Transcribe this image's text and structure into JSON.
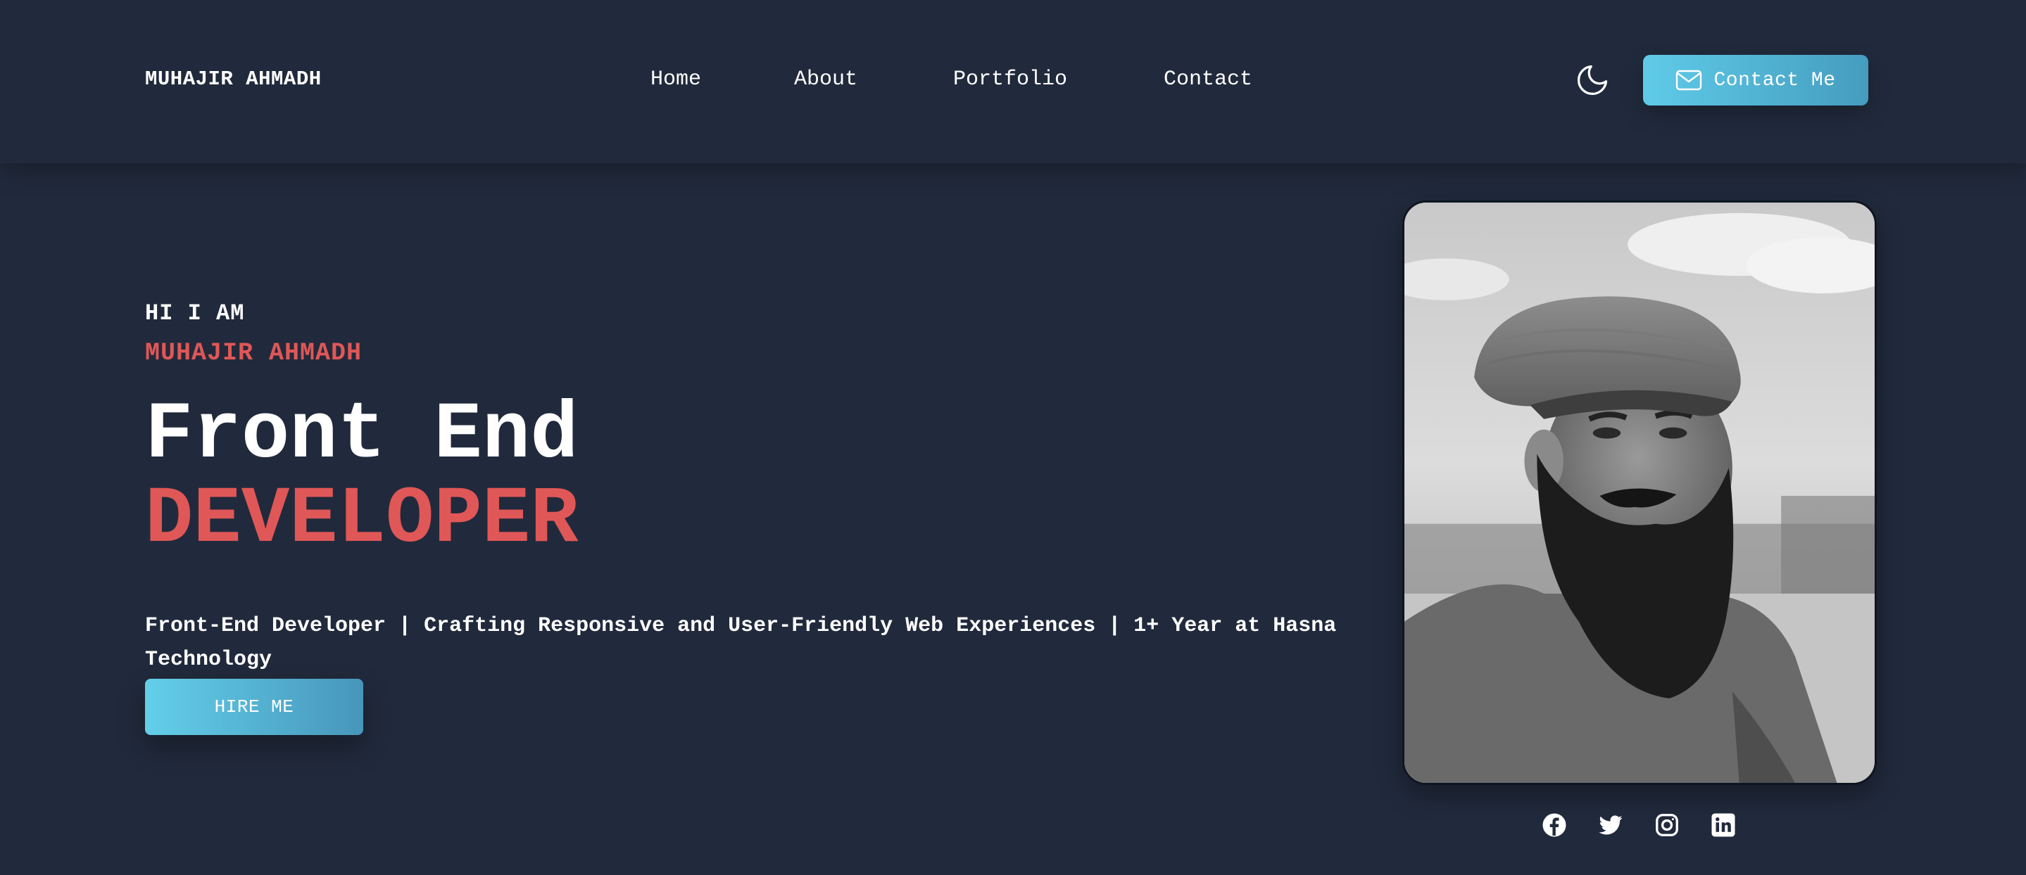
{
  "header": {
    "brand": "MUHAJIR AHMADH",
    "nav": [
      {
        "label": "Home"
      },
      {
        "label": "About"
      },
      {
        "label": "Portfolio"
      },
      {
        "label": "Contact"
      }
    ],
    "theme_toggle_icon": "moon-icon",
    "contact_button": {
      "label": "Contact Me",
      "icon": "mail-icon"
    }
  },
  "hero": {
    "greeting": "HI I AM",
    "name": "MUHAJIR AHMADH",
    "role_line1": "Front End",
    "role_line2": "DEVELOPER",
    "tagline": "Front-End Developer | Crafting Responsive and User-Friendly Web Experiences | 1+ Year at Hasna Technology",
    "hire_button": "HIRE ME",
    "portrait_icon": "profile-photo"
  },
  "socials": [
    {
      "icon": "facebook-icon"
    },
    {
      "icon": "twitter-icon"
    },
    {
      "icon": "instagram-icon"
    },
    {
      "icon": "linkedin-icon"
    }
  ],
  "colors": {
    "background": "#212a3c",
    "accent": "#e05757",
    "button_gradient_start": "#5fcbe8",
    "button_gradient_end": "#459cbf",
    "text": "#ffffff"
  }
}
